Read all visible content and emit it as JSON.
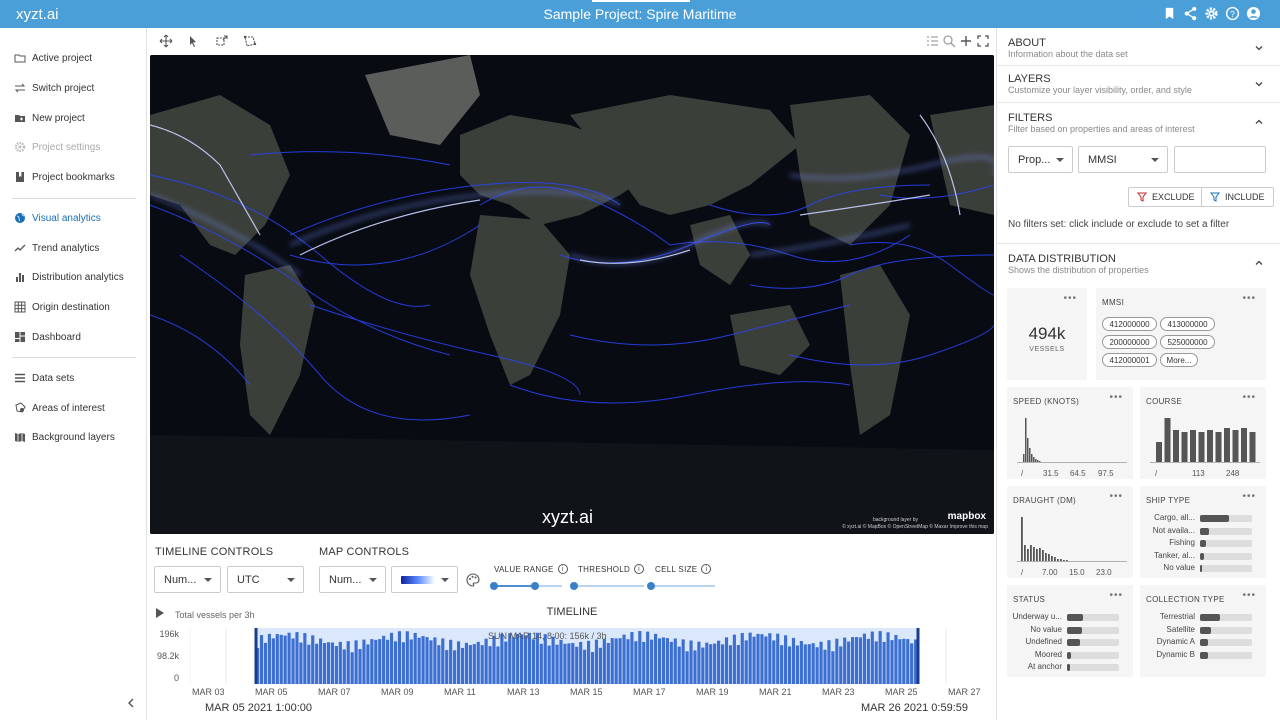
{
  "app": {
    "logo": "xyzt.ai",
    "project_title": "Sample Project: Spire Maritime"
  },
  "header_icons": [
    "bookmark-icon",
    "share-icon",
    "gear-icon",
    "help-icon",
    "account-icon"
  ],
  "sidebar": {
    "group1": [
      {
        "label": "Active project",
        "icon": "folder-icon",
        "disabled": false
      },
      {
        "label": "Switch project",
        "icon": "switch-icon",
        "disabled": false
      },
      {
        "label": "New project",
        "icon": "new-folder-icon",
        "disabled": false
      },
      {
        "label": "Project settings",
        "icon": "gear-icon",
        "disabled": true
      },
      {
        "label": "Project bookmarks",
        "icon": "bookmarks-icon",
        "disabled": false
      }
    ],
    "group2": [
      {
        "label": "Visual analytics",
        "icon": "globe-icon",
        "active": true
      },
      {
        "label": "Trend analytics",
        "icon": "trend-icon",
        "active": false
      },
      {
        "label": "Distribution analytics",
        "icon": "bar-chart-icon",
        "active": false
      },
      {
        "label": "Origin destination",
        "icon": "grid-icon",
        "active": false
      },
      {
        "label": "Dashboard",
        "icon": "dashboard-icon",
        "active": false
      }
    ],
    "group3": [
      {
        "label": "Data sets",
        "icon": "list-icon"
      },
      {
        "label": "Areas of interest",
        "icon": "area-icon"
      },
      {
        "label": "Background layers",
        "icon": "map-icon"
      }
    ]
  },
  "map": {
    "watermark": "xyzt.ai",
    "mapbox": "mapbox",
    "mapbox_by": "background layer by",
    "attribution": "© xyzt.ai © MapBox © OpenStreetMap © Maxar Improve this map"
  },
  "timeline_controls": {
    "title": "TIMELINE CONTROLS",
    "number_select": "Num...",
    "timezone": "UTC"
  },
  "map_controls": {
    "title": "MAP CONTROLS",
    "number_select": "Num...",
    "value_range_label": "VALUE RANGE",
    "threshold_label": "THRESHOLD",
    "cell_size_label": "CELL SIZE",
    "value_range": [
      0,
      0.6
    ],
    "threshold": 0,
    "cell_size": 0
  },
  "timeline": {
    "title": "TIMELINE",
    "subtitle": "Total vessels per 3h",
    "y_ticks": [
      "196k",
      "98.2k",
      "0"
    ],
    "hover": "SUN MAR 14, 8:00: 156k / 3h",
    "x_ticks": [
      "MAR 03",
      "MAR 05",
      "MAR 07",
      "MAR 09",
      "MAR 11",
      "MAR 13",
      "MAR 15",
      "MAR 17",
      "MAR 19",
      "MAR 21",
      "MAR 23",
      "MAR 25",
      "MAR 27"
    ],
    "start": "MAR 05 2021 1:00:00",
    "end": "MAR 26 2021 0:59:59"
  },
  "right_panel": {
    "about": {
      "title": "ABOUT",
      "subtitle": "Information about the data set"
    },
    "layers": {
      "title": "LAYERS",
      "subtitle": "Customize your layer visibility, order, and style"
    },
    "filters": {
      "title": "FILTERS",
      "subtitle": "Filter based on properties and areas of interest",
      "property_select": "Prop...",
      "field_select": "MMSI",
      "value": "",
      "exclude_label": "EXCLUDE",
      "include_label": "INCLUDE",
      "status": "No filters set: click include or exclude to set a filter"
    },
    "distribution": {
      "title": "DATA DISTRIBUTION",
      "subtitle": "Shows the distribution of properties"
    }
  },
  "cards": {
    "vessels": {
      "value": "494k",
      "label": "VESSELS"
    },
    "mmsi": {
      "title": "MMSI",
      "chips": [
        "412000000",
        "413000000",
        "200000000",
        "525000000",
        "412000001",
        "More..."
      ]
    },
    "speed": {
      "title": "SPEED (KNOTS)",
      "ticks": [
        "/",
        "31.5",
        "64.5",
        "97.5"
      ]
    },
    "course": {
      "title": "COURSE",
      "ticks": [
        "/",
        "113",
        "248"
      ]
    },
    "draught": {
      "title": "DRAUGHT (DM)",
      "ticks": [
        "/",
        "7.00",
        "15.0",
        "23.0"
      ]
    },
    "ship_type": {
      "title": "SHIP TYPE",
      "bars": [
        {
          "label": "Cargo, all...",
          "value": 0.55
        },
        {
          "label": "Not availa...",
          "value": 0.18
        },
        {
          "label": "Fishing",
          "value": 0.12
        },
        {
          "label": "Tanker, al...",
          "value": 0.08
        },
        {
          "label": "No value",
          "value": 0.04
        }
      ]
    },
    "status": {
      "title": "STATUS",
      "bars": [
        {
          "label": "Underway u...",
          "value": 0.3
        },
        {
          "label": "No value",
          "value": 0.28
        },
        {
          "label": "Undefined",
          "value": 0.25
        },
        {
          "label": "Moored",
          "value": 0.08
        },
        {
          "label": "At anchor",
          "value": 0.05
        }
      ]
    },
    "collection_type": {
      "title": "COLLECTION TYPE",
      "bars": [
        {
          "label": "Terrestrial",
          "value": 0.38
        },
        {
          "label": "Satellite",
          "value": 0.22
        },
        {
          "label": "Dynamic A",
          "value": 0.15
        },
        {
          "label": "Dynamic B",
          "value": 0.15
        }
      ]
    }
  },
  "colors": {
    "accent": "#4b9fd8",
    "active_nav": "#1a6fb8",
    "bar": "#3c6fd0",
    "track": "#1a2cff"
  }
}
